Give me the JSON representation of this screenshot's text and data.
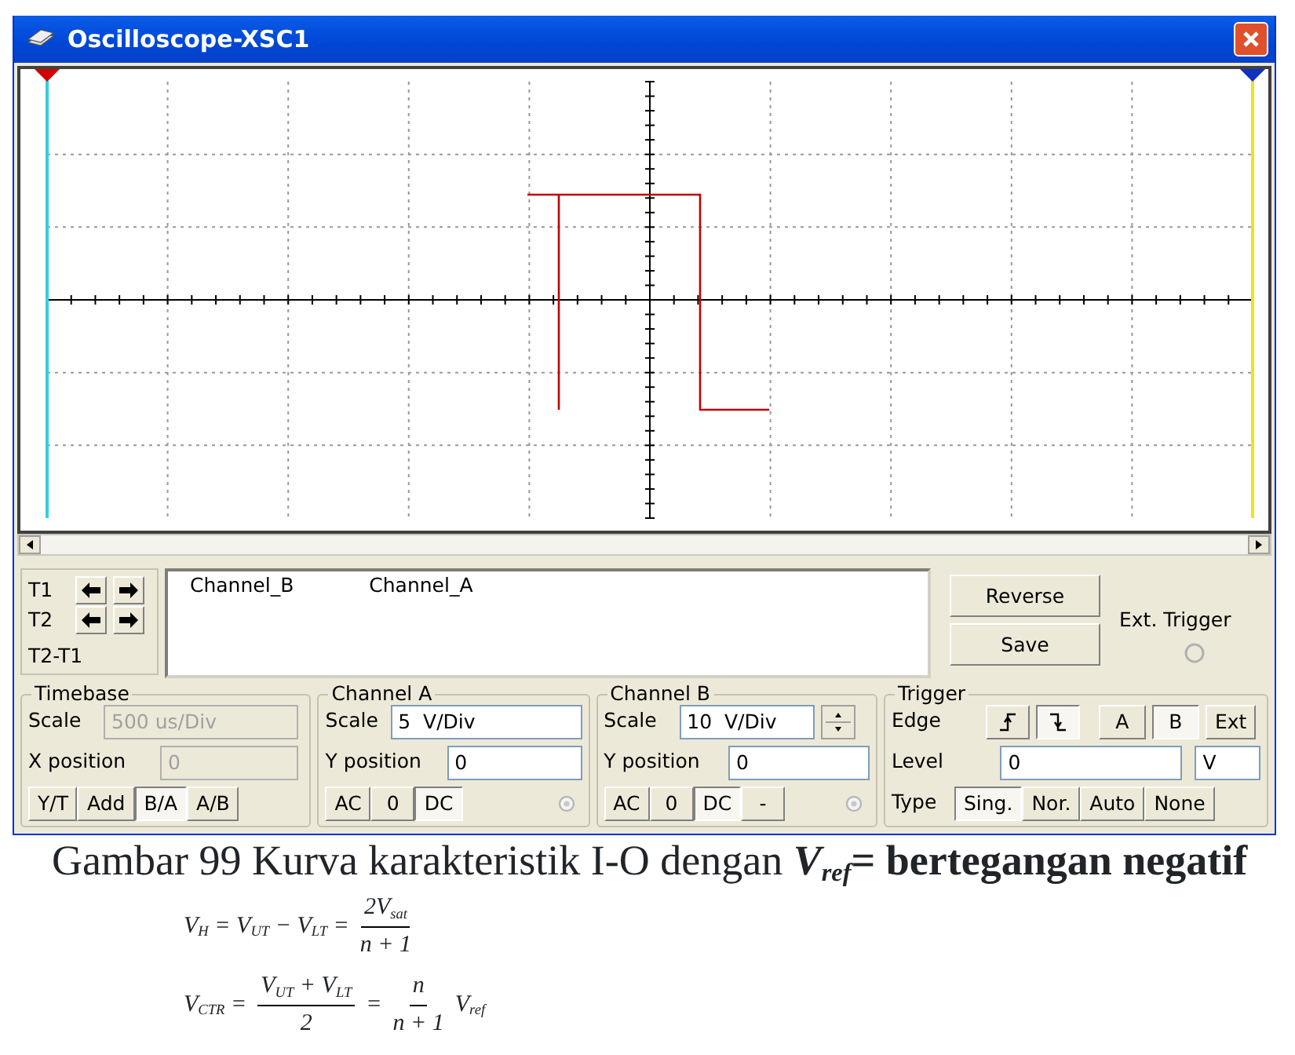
{
  "window": {
    "title": "Oscilloscope-XSC1"
  },
  "cursors": {
    "t1": "T1",
    "t2": "T2",
    "diff": "T2-T1"
  },
  "readout": {
    "columns": [
      "Channel_B",
      "Channel_A"
    ]
  },
  "buttons": [
    "Reverse",
    "Save"
  ],
  "ext_trigger": {
    "label": "Ext. Trigger"
  },
  "timebase": {
    "title": "Timebase",
    "scale_label": "Scale",
    "scale": "500 us/Div",
    "xpos_label": "X position",
    "xpos": "0",
    "disabled": true,
    "modes": [
      {
        "label": "Y/T",
        "selected": false
      },
      {
        "label": "Add",
        "selected": false
      },
      {
        "label": "B/A",
        "selected": true
      },
      {
        "label": "A/B",
        "selected": false
      }
    ]
  },
  "channel_a": {
    "title": "Channel A",
    "scale_label": "Scale",
    "scale": "5  V/Div",
    "ypos_label": "Y position",
    "ypos": "0",
    "coupling": [
      {
        "label": "AC",
        "selected": false
      },
      {
        "label": "0",
        "selected": false
      },
      {
        "label": "DC",
        "selected": true
      }
    ]
  },
  "channel_b": {
    "title": "Channel B",
    "scale_label": "Scale",
    "scale": "10  V/Div",
    "ypos_label": "Y position",
    "ypos": "0",
    "coupling": [
      {
        "label": "AC",
        "selected": false
      },
      {
        "label": "0",
        "selected": false
      },
      {
        "label": "DC",
        "selected": true
      },
      {
        "label": "-",
        "selected": false
      }
    ]
  },
  "trigger": {
    "title": "Trigger",
    "edge_label": "Edge",
    "edges": [
      {
        "kind": "rising",
        "selected": false
      },
      {
        "kind": "falling",
        "selected": true
      }
    ],
    "sources": [
      {
        "label": "A",
        "selected": false
      },
      {
        "label": "B",
        "selected": true
      },
      {
        "label": "Ext",
        "selected": false
      }
    ],
    "level_label": "Level",
    "level_value": "0",
    "level_unit": "V",
    "type_label": "Type",
    "types": [
      {
        "label": "Sing.",
        "selected": true
      },
      {
        "label": "Nor.",
        "selected": false
      },
      {
        "label": "Auto",
        "selected": false
      },
      {
        "label": "None",
        "selected": false
      }
    ]
  },
  "caption": "Gambar 99 Kurva karakteristik I-O dengan *V*$_{ref}$**= bertegangan negatif**",
  "formulas": [
    [
      {
        "kind": "text",
        "text": "V$_{H}$ = V$_{UT}$ − V$_{LT}$ ="
      },
      {
        "kind": "frac",
        "num": "2V$_{sat}$",
        "den": "n + 1"
      }
    ],
    [
      {
        "kind": "text",
        "text": "V$_{CTR}$ ="
      },
      {
        "kind": "frac",
        "num": "V$_{UT}$ + V$_{LT}$",
        "den": "2"
      },
      {
        "kind": "text",
        "text": "="
      },
      {
        "kind": "frac",
        "num": "n",
        "den": "n + 1"
      },
      {
        "kind": "text",
        "text": "V$_{ref}$"
      }
    ]
  ]
}
